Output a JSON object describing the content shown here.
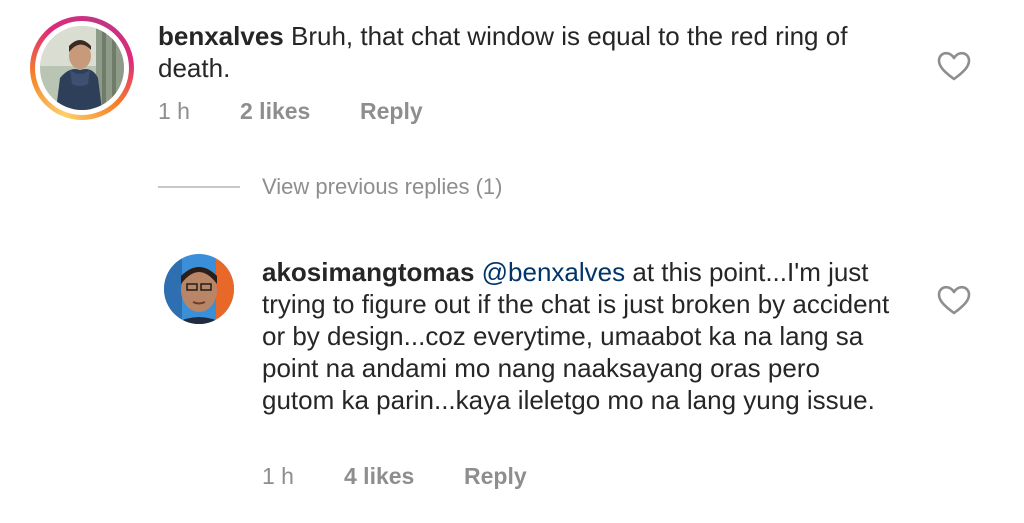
{
  "comments": [
    {
      "username": "benxalves",
      "mention": "",
      "text": "Bruh, that chat window is equal to the red ring of death.",
      "time": "1 h",
      "likes": "2 likes",
      "reply": "Reply"
    },
    {
      "username": "akosimangtomas",
      "mention": "@benxalves",
      "text": "at this point...I'm just trying to figure out if the chat is just broken by accident or by design...coz everytime, umaabot ka na lang sa point na andami mo nang naaksayang oras pero gutom ka parin...kaya ileletgo mo na lang yung issue.",
      "time": "1 h",
      "likes": "4 likes",
      "reply": "Reply"
    }
  ],
  "replies_toggle": {
    "label": "View previous replies (1)"
  },
  "icons": {
    "like": "heart-outline-icon"
  },
  "colors": {
    "text": "#262626",
    "meta": "#8e8e8e",
    "mention": "#003569",
    "story_ring_start": "#fdd06b",
    "story_ring_end": "#c13584"
  }
}
